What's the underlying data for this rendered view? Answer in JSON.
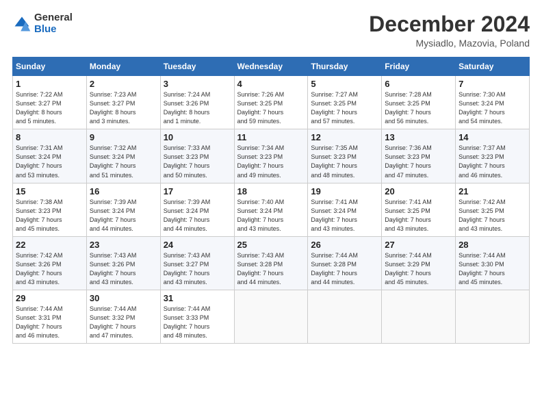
{
  "header": {
    "logo_line1": "General",
    "logo_line2": "Blue",
    "month": "December 2024",
    "location": "Mysiadlo, Mazovia, Poland"
  },
  "weekdays": [
    "Sunday",
    "Monday",
    "Tuesday",
    "Wednesday",
    "Thursday",
    "Friday",
    "Saturday"
  ],
  "weeks": [
    [
      {
        "day": "1",
        "lines": [
          "Sunrise: 7:22 AM",
          "Sunset: 3:27 PM",
          "Daylight: 8 hours",
          "and 5 minutes."
        ]
      },
      {
        "day": "2",
        "lines": [
          "Sunrise: 7:23 AM",
          "Sunset: 3:27 PM",
          "Daylight: 8 hours",
          "and 3 minutes."
        ]
      },
      {
        "day": "3",
        "lines": [
          "Sunrise: 7:24 AM",
          "Sunset: 3:26 PM",
          "Daylight: 8 hours",
          "and 1 minute."
        ]
      },
      {
        "day": "4",
        "lines": [
          "Sunrise: 7:26 AM",
          "Sunset: 3:25 PM",
          "Daylight: 7 hours",
          "and 59 minutes."
        ]
      },
      {
        "day": "5",
        "lines": [
          "Sunrise: 7:27 AM",
          "Sunset: 3:25 PM",
          "Daylight: 7 hours",
          "and 57 minutes."
        ]
      },
      {
        "day": "6",
        "lines": [
          "Sunrise: 7:28 AM",
          "Sunset: 3:25 PM",
          "Daylight: 7 hours",
          "and 56 minutes."
        ]
      },
      {
        "day": "7",
        "lines": [
          "Sunrise: 7:30 AM",
          "Sunset: 3:24 PM",
          "Daylight: 7 hours",
          "and 54 minutes."
        ]
      }
    ],
    [
      {
        "day": "8",
        "lines": [
          "Sunrise: 7:31 AM",
          "Sunset: 3:24 PM",
          "Daylight: 7 hours",
          "and 53 minutes."
        ]
      },
      {
        "day": "9",
        "lines": [
          "Sunrise: 7:32 AM",
          "Sunset: 3:24 PM",
          "Daylight: 7 hours",
          "and 51 minutes."
        ]
      },
      {
        "day": "10",
        "lines": [
          "Sunrise: 7:33 AM",
          "Sunset: 3:23 PM",
          "Daylight: 7 hours",
          "and 50 minutes."
        ]
      },
      {
        "day": "11",
        "lines": [
          "Sunrise: 7:34 AM",
          "Sunset: 3:23 PM",
          "Daylight: 7 hours",
          "and 49 minutes."
        ]
      },
      {
        "day": "12",
        "lines": [
          "Sunrise: 7:35 AM",
          "Sunset: 3:23 PM",
          "Daylight: 7 hours",
          "and 48 minutes."
        ]
      },
      {
        "day": "13",
        "lines": [
          "Sunrise: 7:36 AM",
          "Sunset: 3:23 PM",
          "Daylight: 7 hours",
          "and 47 minutes."
        ]
      },
      {
        "day": "14",
        "lines": [
          "Sunrise: 7:37 AM",
          "Sunset: 3:23 PM",
          "Daylight: 7 hours",
          "and 46 minutes."
        ]
      }
    ],
    [
      {
        "day": "15",
        "lines": [
          "Sunrise: 7:38 AM",
          "Sunset: 3:23 PM",
          "Daylight: 7 hours",
          "and 45 minutes."
        ]
      },
      {
        "day": "16",
        "lines": [
          "Sunrise: 7:39 AM",
          "Sunset: 3:24 PM",
          "Daylight: 7 hours",
          "and 44 minutes."
        ]
      },
      {
        "day": "17",
        "lines": [
          "Sunrise: 7:39 AM",
          "Sunset: 3:24 PM",
          "Daylight: 7 hours",
          "and 44 minutes."
        ]
      },
      {
        "day": "18",
        "lines": [
          "Sunrise: 7:40 AM",
          "Sunset: 3:24 PM",
          "Daylight: 7 hours",
          "and 43 minutes."
        ]
      },
      {
        "day": "19",
        "lines": [
          "Sunrise: 7:41 AM",
          "Sunset: 3:24 PM",
          "Daylight: 7 hours",
          "and 43 minutes."
        ]
      },
      {
        "day": "20",
        "lines": [
          "Sunrise: 7:41 AM",
          "Sunset: 3:25 PM",
          "Daylight: 7 hours",
          "and 43 minutes."
        ]
      },
      {
        "day": "21",
        "lines": [
          "Sunrise: 7:42 AM",
          "Sunset: 3:25 PM",
          "Daylight: 7 hours",
          "and 43 minutes."
        ]
      }
    ],
    [
      {
        "day": "22",
        "lines": [
          "Sunrise: 7:42 AM",
          "Sunset: 3:26 PM",
          "Daylight: 7 hours",
          "and 43 minutes."
        ]
      },
      {
        "day": "23",
        "lines": [
          "Sunrise: 7:43 AM",
          "Sunset: 3:26 PM",
          "Daylight: 7 hours",
          "and 43 minutes."
        ]
      },
      {
        "day": "24",
        "lines": [
          "Sunrise: 7:43 AM",
          "Sunset: 3:27 PM",
          "Daylight: 7 hours",
          "and 43 minutes."
        ]
      },
      {
        "day": "25",
        "lines": [
          "Sunrise: 7:43 AM",
          "Sunset: 3:28 PM",
          "Daylight: 7 hours",
          "and 44 minutes."
        ]
      },
      {
        "day": "26",
        "lines": [
          "Sunrise: 7:44 AM",
          "Sunset: 3:28 PM",
          "Daylight: 7 hours",
          "and 44 minutes."
        ]
      },
      {
        "day": "27",
        "lines": [
          "Sunrise: 7:44 AM",
          "Sunset: 3:29 PM",
          "Daylight: 7 hours",
          "and 45 minutes."
        ]
      },
      {
        "day": "28",
        "lines": [
          "Sunrise: 7:44 AM",
          "Sunset: 3:30 PM",
          "Daylight: 7 hours",
          "and 45 minutes."
        ]
      }
    ],
    [
      {
        "day": "29",
        "lines": [
          "Sunrise: 7:44 AM",
          "Sunset: 3:31 PM",
          "Daylight: 7 hours",
          "and 46 minutes."
        ]
      },
      {
        "day": "30",
        "lines": [
          "Sunrise: 7:44 AM",
          "Sunset: 3:32 PM",
          "Daylight: 7 hours",
          "and 47 minutes."
        ]
      },
      {
        "day": "31",
        "lines": [
          "Sunrise: 7:44 AM",
          "Sunset: 3:33 PM",
          "Daylight: 7 hours",
          "and 48 minutes."
        ]
      },
      null,
      null,
      null,
      null
    ]
  ]
}
